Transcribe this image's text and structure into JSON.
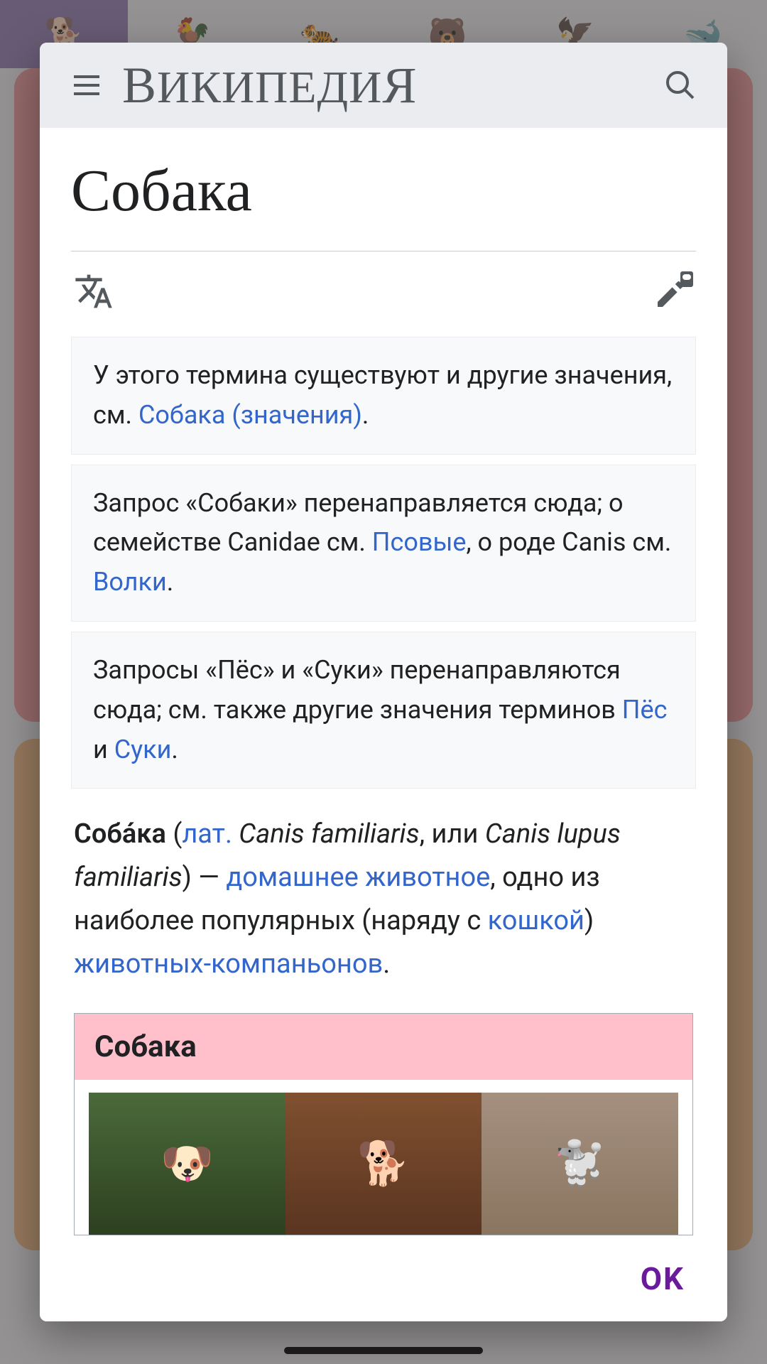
{
  "background": {
    "tabs": [
      "🐕",
      "🐓",
      "🐅",
      "🐻",
      "🦅",
      "🐋"
    ],
    "active_tab": 0
  },
  "wiki": {
    "site_name_html": "ВикипедиЯ",
    "site_name_parts": {
      "a": "В",
      "b": "ИКИПЕДИ",
      "c": "Я"
    },
    "article_title": "Собака",
    "disambig_boxes": [
      {
        "pre": "У этого термина существуют и другие значения, см. ",
        "link": "Собака (значения)",
        "post": "."
      },
      {
        "text_parts": [
          "Запрос «Собаки» перенаправляется сюда; о семействе Canidae см. ",
          {
            "link": "Псовые"
          },
          ", о роде Canis см. ",
          {
            "link": "Волки"
          },
          "."
        ]
      },
      {
        "text_parts": [
          "Запросы «Пёс» и «Суки» перенаправляются сюда; см. также другие значения терминов ",
          {
            "link": "Пёс"
          },
          " и ",
          {
            "link": "Суки"
          },
          "."
        ]
      }
    ],
    "lead": {
      "bold": "Соба́ка",
      "open": " (",
      "lat_link": "лат.",
      "italic1": " Canis familiaris",
      "mid1": ", или ",
      "italic2": "Canis lupus familiaris",
      "close": ") — ",
      "link1": "домашнее животное",
      "t1": ", одно из наиболее популярных (наряду с ",
      "link2": "кошкой",
      "t2": ") ",
      "link3": "животных-компаньонов",
      "t3": "."
    },
    "infobox_title": "Собака",
    "infobox_images": [
      "🐶",
      "🐕",
      "🐩"
    ]
  },
  "modal": {
    "ok_label": "OK"
  }
}
